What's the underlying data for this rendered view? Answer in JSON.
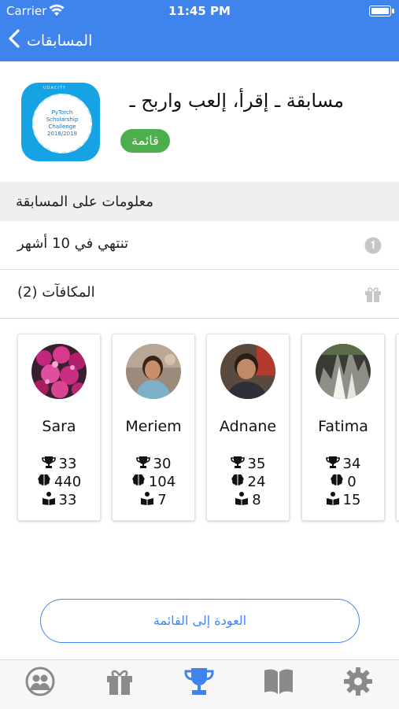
{
  "status_bar": {
    "carrier": "Carrier",
    "time": "11:45 PM"
  },
  "nav": {
    "back_label": "المسابقات"
  },
  "competition": {
    "logo_text": {
      "top": "UDACITY",
      "line1": "PyTorch",
      "line2": "Scholarship",
      "line3": "Challenge",
      "line4": "2018/2019"
    },
    "title": "مسابقة ـ إقرأ، إلعب واربح ـ",
    "status": "قائمة"
  },
  "info_section": {
    "header": "معلومات على المسابقة",
    "ends_in": "تنتهي في  10 أشهر",
    "rewards": "المكافآت (2)"
  },
  "participants": [
    {
      "name": "Sara",
      "trophies": "33",
      "brain": "440",
      "books": "33"
    },
    {
      "name": "Meriem",
      "trophies": "30",
      "brain": "104",
      "books": "7"
    },
    {
      "name": "Adnane",
      "trophies": "35",
      "brain": "24",
      "books": "8"
    },
    {
      "name": "Fatima",
      "trophies": "34",
      "brain": "0",
      "books": "15"
    }
  ],
  "back_to_list": "العودة إلى القائمة",
  "colors": {
    "primary": "#3f84ec",
    "badge_green": "#4cae4c",
    "tab_active": "#3f84ec",
    "tab_inactive": "#8a8a8a"
  },
  "tabs": [
    {
      "icon": "friends-icon",
      "active": false
    },
    {
      "icon": "gift-icon",
      "active": false
    },
    {
      "icon": "trophy-icon",
      "active": true
    },
    {
      "icon": "book-icon",
      "active": false
    },
    {
      "icon": "gear-icon",
      "active": false
    }
  ]
}
